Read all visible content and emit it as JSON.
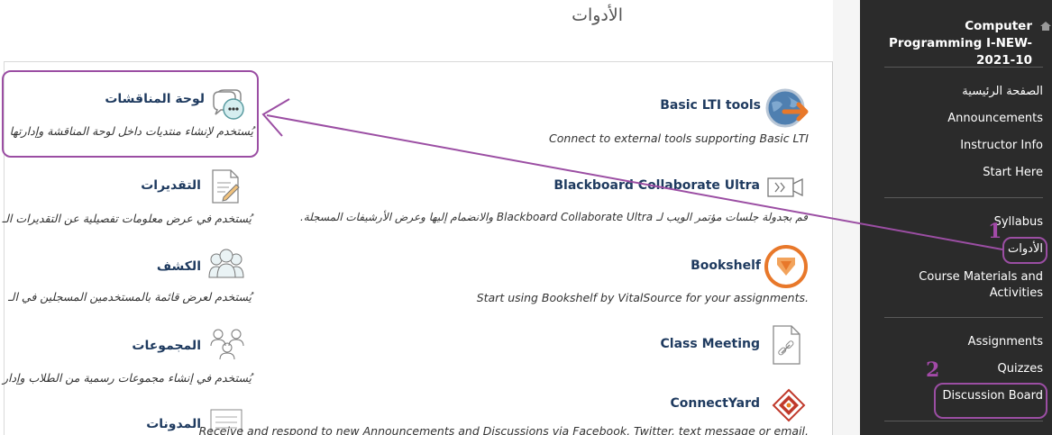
{
  "page": {
    "title": "الأدوات"
  },
  "tools_left": [
    {
      "title": "لوحة المناقشات",
      "desc": "يُستخدم لإنشاء منتديات داخل لوحة المناقشة وإدارتها"
    },
    {
      "title": "التقديرات",
      "desc": "يُستخدم في عرض معلومات تفصيلية عن التقديرات الـ"
    },
    {
      "title": "الكشف",
      "desc": "يُستخدم لعرض قائمة بالمستخدمين المسجلين في الـ"
    },
    {
      "title": "المجموعات",
      "desc": "يُستخدم في إنشاء مجموعات رسمية من الطلاب وإدار"
    },
    {
      "title": "المدونات",
      "desc": ""
    }
  ],
  "tools_right": [
    {
      "title": "Basic LTI tools",
      "desc": "Connect to external tools supporting Basic LTI"
    },
    {
      "title": "Blackboard Collaborate Ultra",
      "desc": "قم بجدولة جلسات مؤتمر الويب لـ Blackboard Collaborate Ultra والانضمام إليها وعرض الأرشيفات المسجلة."
    },
    {
      "title": "Bookshelf",
      "desc": "Start using Bookshelf by VitalSource for your assignments."
    },
    {
      "title": "Class Meeting",
      "desc": ""
    },
    {
      "title": "ConnectYard",
      "desc": "Receive and respond to new Announcements and Discussions via Facebook, Twitter, text message or email."
    }
  ],
  "sidebar": {
    "course_title": "Computer Programming I-NEW-2021-10",
    "group1": [
      "الصفحة الرئيسية",
      "Announcements",
      "Instructor Info",
      "Start Here"
    ],
    "group2": [
      "Syllabus",
      "الأدوات",
      "Course Materials and Activities"
    ],
    "group3": [
      "Assignments",
      "Quizzes",
      "Discussion Board"
    ]
  },
  "annotations": {
    "num1": "1",
    "num2": "2"
  },
  "colors": {
    "annotation": "#9b4ea3",
    "sidebar_bg": "#2b2b2b",
    "link": "#1e3a5f"
  }
}
